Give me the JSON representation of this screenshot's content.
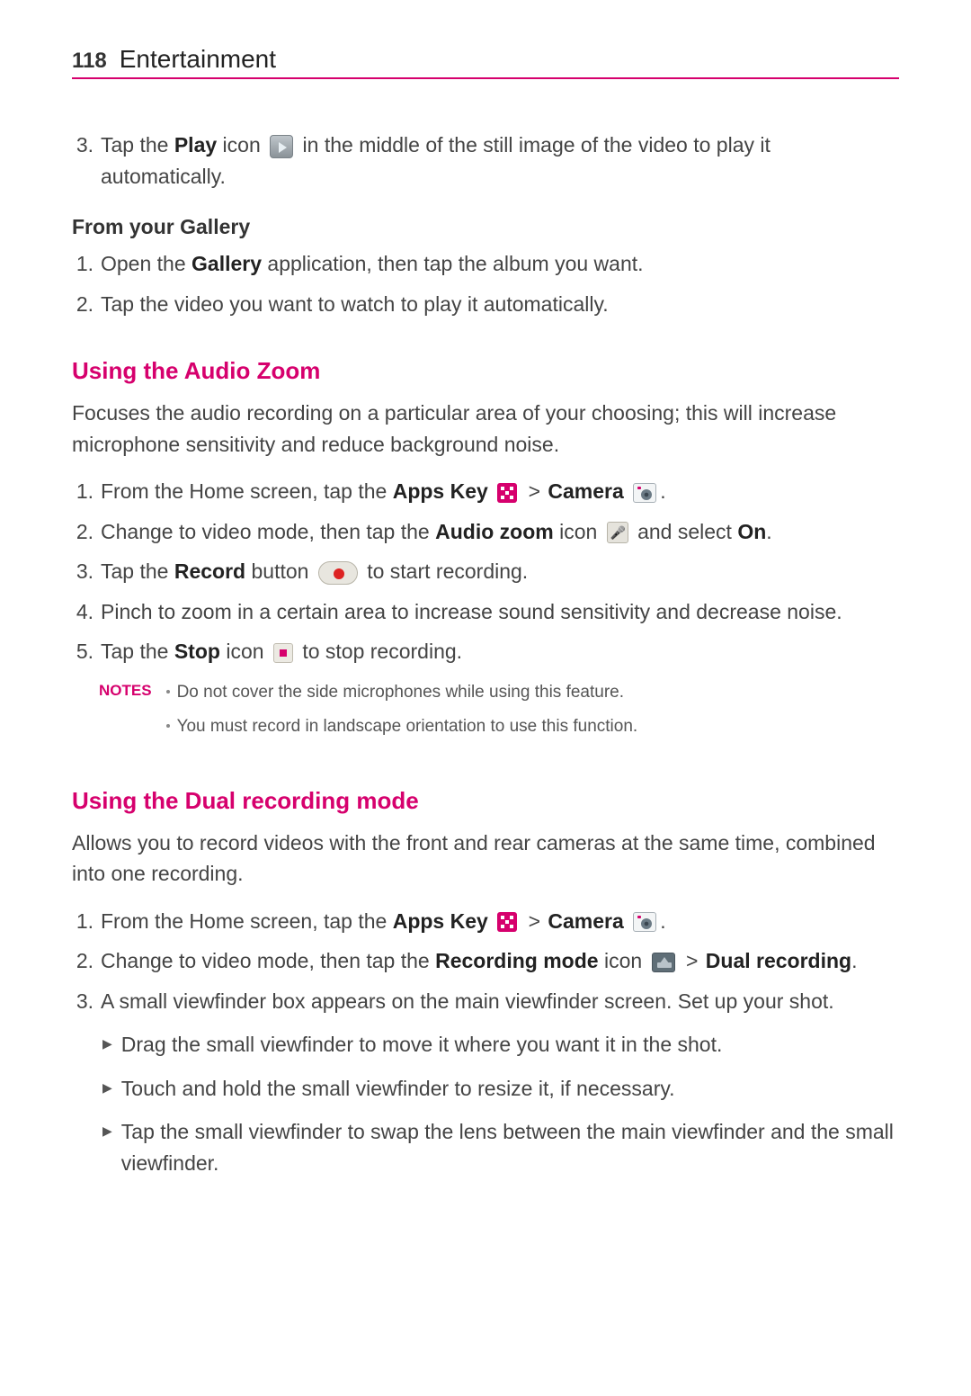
{
  "header": {
    "page_number": "118",
    "chapter": "Entertainment"
  },
  "intro_step": {
    "num": "3.",
    "t1": "Tap the ",
    "play": "Play",
    "t2": " icon ",
    "t3": " in the middle of the still image of the video to play it automatically."
  },
  "gallery": {
    "title": "From your Gallery",
    "steps": [
      {
        "num": "1.",
        "t1": "Open the ",
        "bold": "Gallery",
        "t2": " application, then tap the album you want."
      },
      {
        "num": "2.",
        "t1": "Tap the video you want to watch to play it automatically."
      }
    ]
  },
  "audiozoom": {
    "title": "Using the Audio Zoom",
    "intro": "Focuses the audio recording on a particular area of your choosing; this will increase microphone sensitivity and reduce background noise.",
    "step1": {
      "num": "1.",
      "t1": "From the Home screen, tap the ",
      "b1": "Apps Key",
      "gt": ">",
      "b2": "Camera",
      "dot": "."
    },
    "step2": {
      "num": "2.",
      "t1": "Change to video mode, then tap the ",
      "b1": "Audio zoom",
      "t2": " icon ",
      "t3": " and select ",
      "b2": "On",
      "dot": "."
    },
    "step3": {
      "num": "3.",
      "t1": "Tap the ",
      "b1": "Record",
      "t2": " button ",
      "t3": " to start recording."
    },
    "step4": {
      "num": "4.",
      "t1": "Pinch to zoom in a certain area to increase sound sensitivity and decrease noise."
    },
    "step5": {
      "num": "5.",
      "t1": "Tap the ",
      "b1": "Stop",
      "t2": " icon ",
      "t3": " to stop recording."
    },
    "notes_label": "NOTES",
    "notes": [
      "Do not cover the side microphones while using this feature.",
      "You must record in landscape orientation to use this function."
    ]
  },
  "dual": {
    "title": "Using the Dual recording mode",
    "intro": "Allows you to record videos with the front and rear cameras at the same time, combined into one recording.",
    "step1": {
      "num": "1.",
      "t1": "From the Home screen, tap the ",
      "b1": "Apps Key",
      "gt": ">",
      "b2": "Camera",
      "dot": "."
    },
    "step2": {
      "num": "2.",
      "t1": "Change to video mode, then tap the ",
      "b1": "Recording mode",
      "t2": " icon ",
      "gt": ">",
      "b2": "Dual recording",
      "dot": "."
    },
    "step3": {
      "num": "3.",
      "t1": "A small viewfinder box appears on the main viewfinder screen. Set up your shot."
    },
    "bullets": [
      "Drag the small viewfinder to move it where you want it in the shot.",
      "Touch and hold the small viewfinder to resize it, if necessary.",
      "Tap the small viewfinder to swap the lens between the main viewfinder and the small viewfinder."
    ]
  }
}
